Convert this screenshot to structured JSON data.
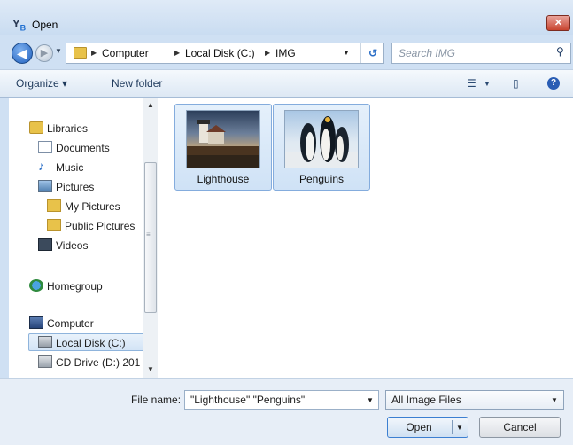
{
  "window": {
    "title": "Open",
    "close_glyph": "✕"
  },
  "nav": {
    "back_glyph": "◀",
    "forward_glyph": "▶",
    "breadcrumb": [
      "Computer",
      "Local Disk (C:)",
      "IMG"
    ],
    "separator": "▶",
    "refresh_glyph": "↺",
    "search_placeholder": "Search IMG"
  },
  "toolbar": {
    "organize_label": "Organize ▾",
    "new_folder_label": "New folder"
  },
  "sidebar": {
    "items": [
      {
        "label": "Libraries",
        "icon": "libraries-icon"
      },
      {
        "label": "Documents",
        "icon": "documents-icon"
      },
      {
        "label": "Music",
        "icon": "music-icon"
      },
      {
        "label": "Pictures",
        "icon": "pictures-icon"
      },
      {
        "label": "My Pictures",
        "icon": "folder-icon"
      },
      {
        "label": "Public Pictures",
        "icon": "folder-icon"
      },
      {
        "label": "Videos",
        "icon": "videos-icon"
      },
      {
        "label": "Homegroup",
        "icon": "homegroup-icon"
      },
      {
        "label": "Computer",
        "icon": "computer-icon"
      },
      {
        "label": "Local Disk (C:)",
        "icon": "drive-icon",
        "selected": true
      },
      {
        "label": "CD Drive (D:) 201",
        "icon": "cd-drive-icon"
      }
    ]
  },
  "files": [
    {
      "name": "Lighthouse",
      "selected": true
    },
    {
      "name": "Penguins",
      "selected": true
    }
  ],
  "footer": {
    "file_name_label": "File name:",
    "file_name_value": "\"Lighthouse\" \"Penguins\"",
    "file_type_value": "All Image Files",
    "open_label": "Open",
    "cancel_label": "Cancel"
  },
  "colors": {
    "selection": "#cfe2f6",
    "accent": "#3c7fd1",
    "close": "#c8442f"
  }
}
